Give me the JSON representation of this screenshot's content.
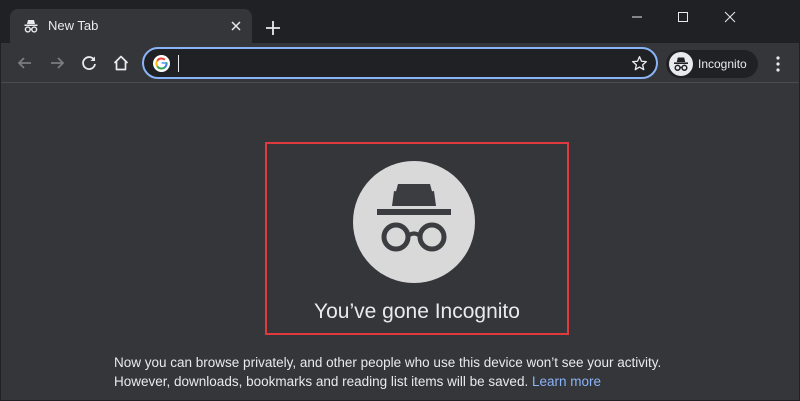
{
  "tab": {
    "title": "New Tab",
    "favicon": "incognito-icon",
    "close_icon": "close-icon"
  },
  "window_controls": [
    "minimize-icon",
    "maximize-icon",
    "close-icon"
  ],
  "toolbar": {
    "back_icon": "back-arrow-icon",
    "forward_icon": "forward-arrow-icon",
    "reload_icon": "reload-icon",
    "home_icon": "home-icon",
    "omnibox_value": "",
    "star_icon": "star-icon",
    "profile_label": "Incognito",
    "menu_icon": "kebab-menu-icon"
  },
  "content": {
    "title": "You’ve gone Incognito",
    "line1": "Now you can browse privately, and other people who use this device won’t see your activity.",
    "line2": "However, downloads, bookmarks and reading list items will be saved.",
    "learn_more": "Learn more"
  },
  "colors": {
    "background": "#35363a",
    "titlebar": "#202124",
    "accent_link": "#8ab4f8",
    "highlight_border": "#e0393e",
    "hero_circle": "#d9d9da"
  }
}
